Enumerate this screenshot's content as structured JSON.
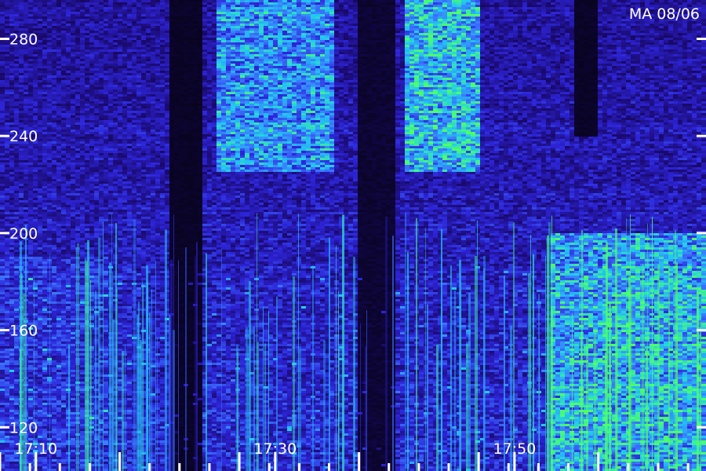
{
  "chart_data": {
    "type": "heatmap",
    "title": "MA 08/06",
    "xlabel": "",
    "ylabel": "",
    "x_ticks": [
      "17:10",
      "17:30",
      "17:50"
    ],
    "y_ticks": [
      120,
      160,
      200,
      240,
      280
    ],
    "ylim": [
      102,
      296
    ],
    "xlim": [
      "17:07",
      "18:06"
    ],
    "grid": false,
    "colormap": [
      "#050312",
      "#1a0a6e",
      "#2d24d8",
      "#3a78ff",
      "#21c8f0",
      "#4dff6a"
    ],
    "intensity_regions": [
      {
        "t_start": "17:07",
        "t_end": "17:16",
        "f_low": 102,
        "f_high": 190,
        "level": 0.45
      },
      {
        "t_start": "17:21",
        "t_end": "17:24",
        "f_low": 102,
        "f_high": 296,
        "level": 0.05
      },
      {
        "t_start": "17:25",
        "t_end": "17:35",
        "f_low": 225,
        "f_high": 296,
        "level": 0.7
      },
      {
        "t_start": "17:37",
        "t_end": "17:40",
        "f_low": 102,
        "f_high": 296,
        "level": 0.08
      },
      {
        "t_start": "17:41",
        "t_end": "17:47",
        "f_low": 225,
        "f_high": 296,
        "level": 0.8
      },
      {
        "t_start": "17:55",
        "t_end": "17:57",
        "f_low": 240,
        "f_high": 296,
        "level": 0.05
      },
      {
        "t_start": "17:53",
        "t_end": "18:06",
        "f_low": 102,
        "f_high": 200,
        "level": 0.75
      }
    ]
  }
}
